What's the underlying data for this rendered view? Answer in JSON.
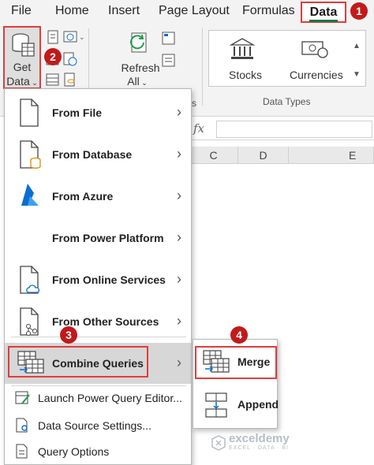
{
  "ribbon_tabs": [
    "File",
    "Home",
    "Insert",
    "Page Layout",
    "Formulas",
    "Data"
  ],
  "active_tab": "Data",
  "ribbon": {
    "get_data_line1": "Get",
    "get_data_line2": "Data",
    "refresh_line1": "Refresh",
    "refresh_line2": "All",
    "data_types": [
      "Stocks",
      "Currencies"
    ],
    "group_label_data_types": "Data Types",
    "group_label_partial": "s"
  },
  "formula_bar": {
    "fx": "fx"
  },
  "column_headers": [
    "C",
    "D",
    "E"
  ],
  "menu": {
    "items": [
      {
        "label": "From File"
      },
      {
        "label": "From Database"
      },
      {
        "label": "From Azure"
      },
      {
        "label": "From Power Platform"
      },
      {
        "label": "From Online Services"
      },
      {
        "label": "From Other Sources"
      },
      {
        "label": "Combine Queries"
      }
    ],
    "simple_items": [
      {
        "label": "Launch Power Query Editor..."
      },
      {
        "label": "Data Source Settings..."
      },
      {
        "label": "Query Options"
      }
    ]
  },
  "submenu": {
    "items": [
      {
        "label": "Merge"
      },
      {
        "label": "Append"
      }
    ]
  },
  "badges": [
    "1",
    "2",
    "3",
    "4"
  ],
  "watermark": {
    "name": "exceldemy",
    "tagline": "EXCEL · DATA · BI"
  },
  "colors": {
    "highlight_border": "#e03c3c",
    "badge": "#c21a1a",
    "accent_green": "#217346",
    "azure_blue": "#0a6ed1"
  }
}
